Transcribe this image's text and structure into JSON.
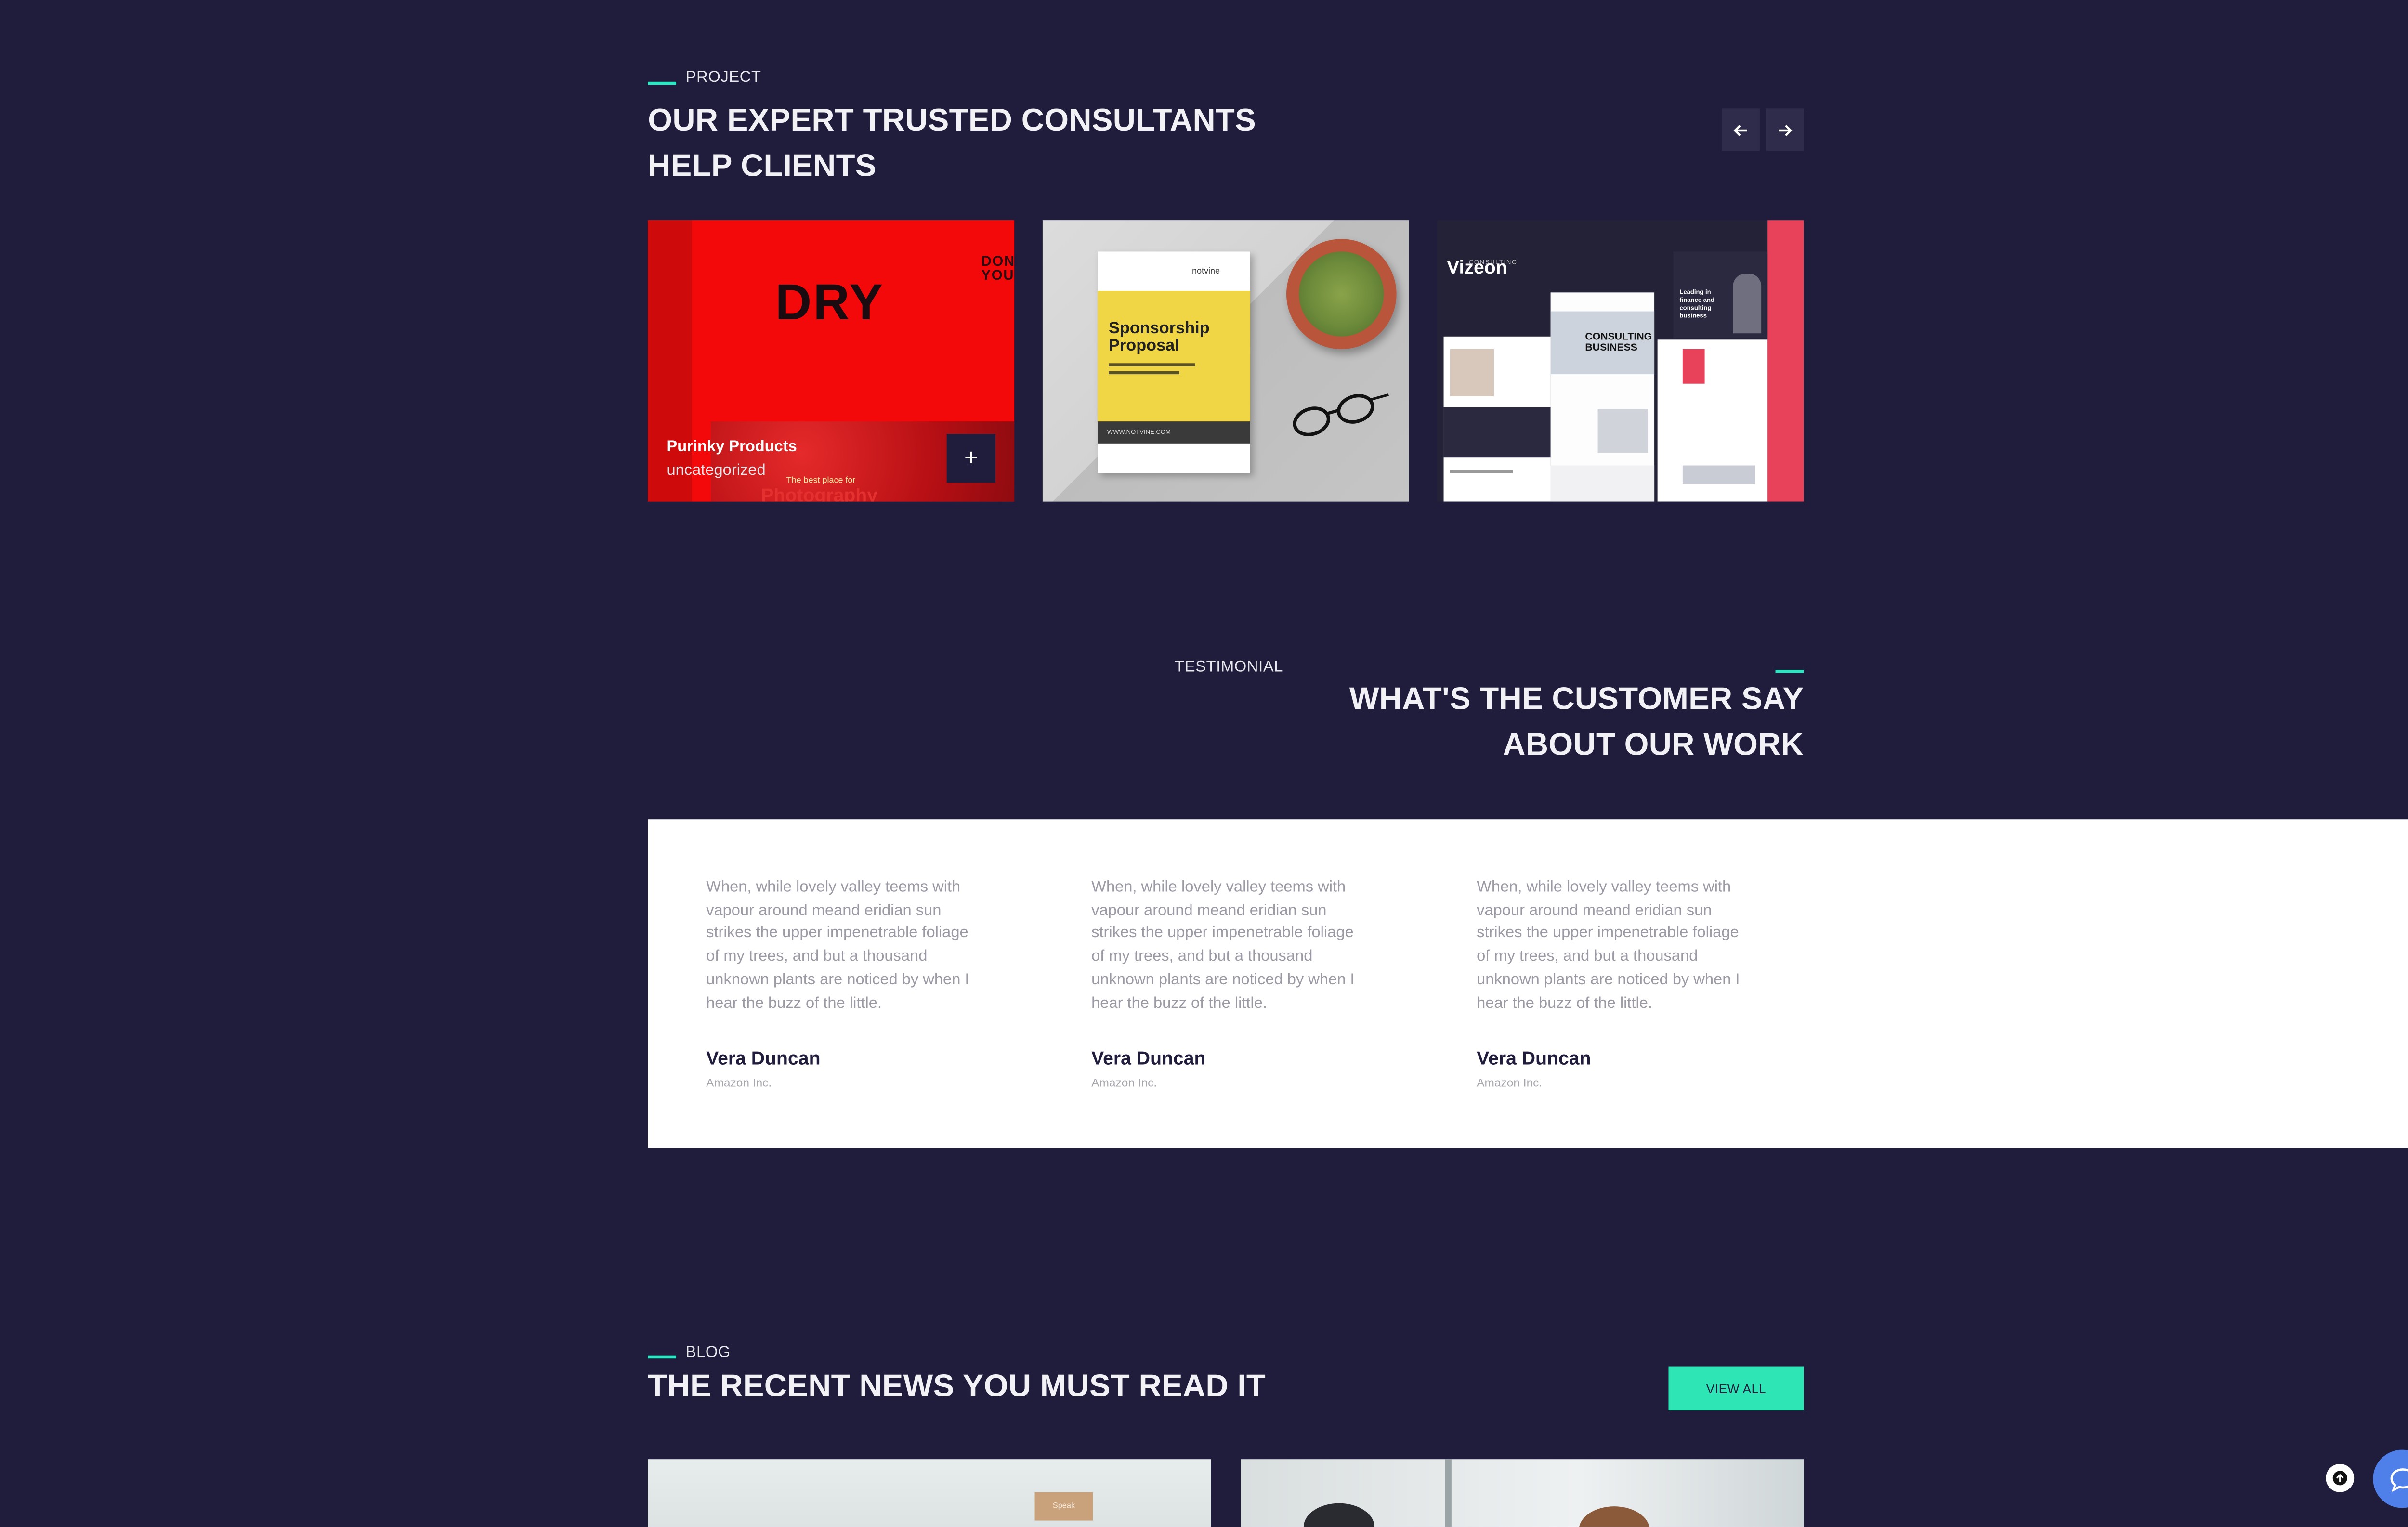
{
  "project": {
    "eyebrow": "PROJECT",
    "title_line1": "OUR EXPERT TRUSTED CONSULTANTS",
    "title_line2": "HELP CLIENTS",
    "prev_icon": "arrow-left-icon",
    "next_icon": "arrow-right-icon",
    "cards": [
      {
        "title": "Purinky Products",
        "category": "uncategorized",
        "art_word": "DRY",
        "art_side": "DON YOU",
        "art_bottom": "Photography",
        "art_bottom_small": "The best place for",
        "action_icon": "plus-icon",
        "action_glyph": "+"
      },
      {
        "brand": "notvine",
        "doc_title_line1": "Sponsorship",
        "doc_title_line2": "Proposal",
        "doc_footer": "WWW.NOTVINE.COM"
      },
      {
        "brand_small": "CONSULTING",
        "brand": "Vizeon",
        "hero_text": "Leading in finance and consulting business",
        "mid_text": "CONSULTING BUSINESS"
      }
    ]
  },
  "testimonial": {
    "eyebrow": "TESTIMONIAL",
    "title_line1": "WHAT'S THE CUSTOMER SAY",
    "title_line2": "ABOUT OUR WORK",
    "items": [
      {
        "quote": "When, while lovely valley teems with vapour around meand eridian sun strikes the upper impenetrable foliage of my trees, and but a thousand unknown plants are noticed by when I hear the buzz of the little.",
        "name": "Vera Duncan",
        "company": "Amazon Inc."
      },
      {
        "quote": "When, while lovely valley teems with vapour around meand eridian sun strikes the upper impenetrable foliage of my trees, and but a thousand unknown plants are noticed by when I hear the buzz of the little.",
        "name": "Vera Duncan",
        "company": "Amazon Inc."
      },
      {
        "quote": "When, while lovely valley teems with vapour around meand eridian sun strikes the upper impenetrable foliage of my trees, and but a thousand unknown plants are noticed by when I hear the buzz of the little.",
        "name": "Vera Duncan",
        "company": "Amazon Inc."
      }
    ]
  },
  "blog": {
    "eyebrow": "BLOG",
    "title": "THE RECENT NEWS YOU MUST READ IT",
    "view_all": "VIEW ALL",
    "card1_tag": "Speak"
  },
  "floating": {
    "scroll_top_icon": "arrow-up-icon",
    "chat_icon": "chat-bubble-icon"
  },
  "colors": {
    "background": "#1f1d3b",
    "accent": "#2ee6b5",
    "card_red": "#f4090b",
    "chat_blue": "#4f7fe9"
  }
}
